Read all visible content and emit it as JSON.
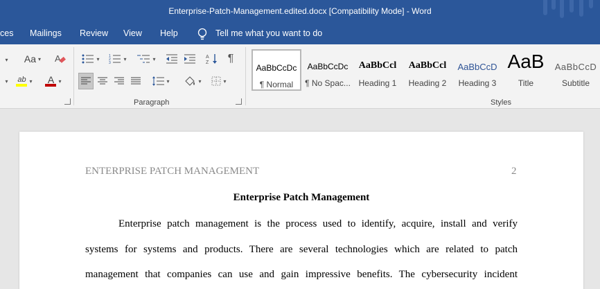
{
  "window": {
    "title": "Enterprise-Patch-Management.edited.docx [Compatibility Mode]  -  Word"
  },
  "tabs": [
    {
      "label": "ces"
    },
    {
      "label": "Mailings"
    },
    {
      "label": "Review"
    },
    {
      "label": "View"
    },
    {
      "label": "Help"
    }
  ],
  "tell_me": {
    "placeholder": "Tell me what you want to do"
  },
  "ribbon": {
    "font_group": {
      "change_case_label": "Aa",
      "highlight_label": "ab",
      "font_color_label": "A",
      "highlight_color": "#ffff00",
      "font_color": "#c00000"
    },
    "paragraph_group": {
      "label": "Paragraph",
      "pilcrow": "¶"
    },
    "styles_group": {
      "label": "Styles",
      "items": [
        {
          "sample": "AaBbCcDc",
          "name": "¶ Normal"
        },
        {
          "sample": "AaBbCcDc",
          "name": "¶ No Spac..."
        },
        {
          "sample": "AaBbCcl",
          "name": "Heading 1"
        },
        {
          "sample": "AaBbCcl",
          "name": "Heading 2"
        },
        {
          "sample": "AaBbCcD",
          "name": "Heading 3"
        },
        {
          "sample": "AaB",
          "name": "Title"
        },
        {
          "sample": "AaBbCcD",
          "name": "Subtitle"
        }
      ]
    }
  },
  "document": {
    "header_text": "ENTERPRISE PATCH MANAGEMENT",
    "page_number": "2",
    "title": "Enterprise Patch Management",
    "lines": [
      "Enterprise patch management is the process used to identify, acquire, install and verify",
      "systems for systems and products. There are several technologies which are related to patch",
      "management that companies can use and gain impressive benefits.  The cybersecurity incident"
    ]
  }
}
